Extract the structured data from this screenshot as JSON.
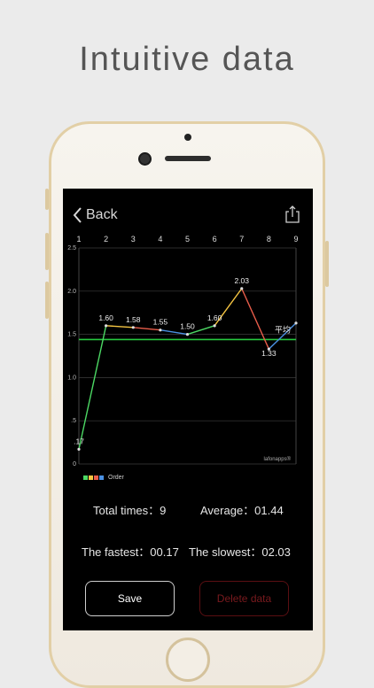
{
  "promo": {
    "headline": "Intuitive data"
  },
  "nav": {
    "back_label": "Back",
    "share_icon": "share-icon"
  },
  "chart_data": {
    "type": "line",
    "categories": [
      "1",
      "2",
      "3",
      "4",
      "5",
      "6",
      "7",
      "8",
      "9"
    ],
    "x_tick_labels": [
      "1",
      "2",
      "3",
      "4",
      "5",
      "6",
      "7",
      "8",
      "9"
    ],
    "y_tick_labels": [
      "2.5",
      "2.0",
      "1.5",
      "1.0",
      ".5",
      "0"
    ],
    "ylim": [
      0,
      2.5
    ],
    "values": [
      0.17,
      1.6,
      1.58,
      1.55,
      1.5,
      1.6,
      2.03,
      1.33,
      1.63
    ],
    "point_labels": [
      ".17",
      "1.60",
      "1.58",
      "1.55",
      "1.50",
      "1.60",
      "2.03",
      "1.33",
      ""
    ],
    "segment_colors": [
      "#4cd964",
      "#f5c542",
      "#e85d4a",
      "#4a90e2",
      "#4cd964",
      "#f5c542",
      "#e85d4a",
      "#4a90e2"
    ],
    "average": 1.44,
    "average_label": "平均",
    "average_color": "#27c93f",
    "watermark": "lafonapps®",
    "grid": true
  },
  "legend": {
    "label": "Order",
    "colors": [
      "#4cd964",
      "#f5c542",
      "#e85d4a",
      "#4a90e2"
    ]
  },
  "stats": {
    "total_times": "Total times：9",
    "average": "Average：01.44",
    "fastest": "The fastest：00.17",
    "slowest": "The slowest：02.03"
  },
  "actions": {
    "save_label": "Save",
    "delete_label": "Delete data"
  }
}
